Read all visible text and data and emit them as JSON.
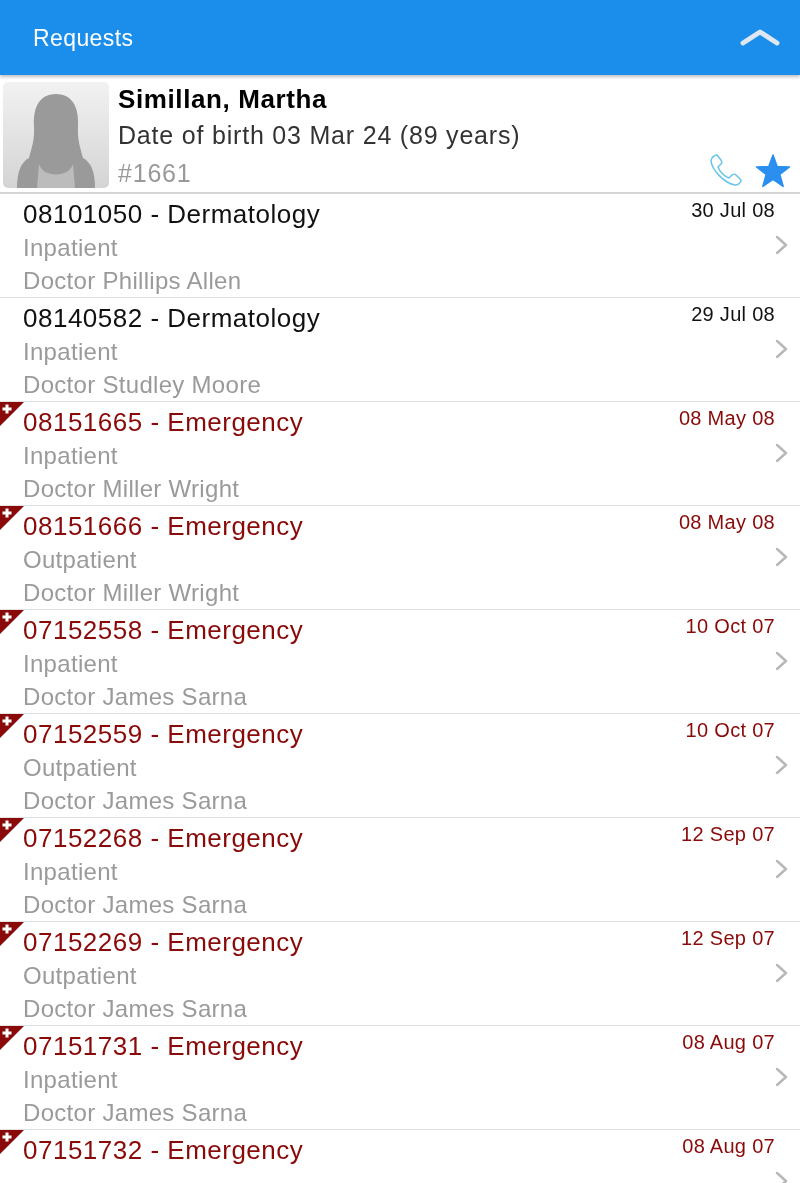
{
  "header": {
    "title": "Requests"
  },
  "patient": {
    "name": "Simillan, Martha",
    "date_of_birth": "Date of birth 03 Mar 24 (89 years)",
    "number": "#1661",
    "favorite": true
  },
  "requests": [
    {
      "title": "08101050 - Dermatology",
      "date": "30 Jul 08",
      "admission": "Inpatient",
      "doctor": "Doctor Phillips Allen",
      "emergency": false
    },
    {
      "title": "08140582 - Dermatology",
      "date": "29 Jul 08",
      "admission": "Inpatient",
      "doctor": "Doctor Studley Moore",
      "emergency": false
    },
    {
      "title": "08151665 - Emergency",
      "date": "08 May 08",
      "admission": "Inpatient",
      "doctor": "Doctor Miller Wright",
      "emergency": true
    },
    {
      "title": "08151666 - Emergency",
      "date": "08 May 08",
      "admission": "Outpatient",
      "doctor": "Doctor Miller Wright",
      "emergency": true
    },
    {
      "title": "07152558 - Emergency",
      "date": "10 Oct 07",
      "admission": "Inpatient",
      "doctor": "Doctor James Sarna",
      "emergency": true
    },
    {
      "title": "07152559 - Emergency",
      "date": "10 Oct 07",
      "admission": "Outpatient",
      "doctor": "Doctor James Sarna",
      "emergency": true
    },
    {
      "title": "07152268 - Emergency",
      "date": "12 Sep 07",
      "admission": "Inpatient",
      "doctor": "Doctor James Sarna",
      "emergency": true
    },
    {
      "title": "07152269 - Emergency",
      "date": "12 Sep 07",
      "admission": "Outpatient",
      "doctor": "Doctor James Sarna",
      "emergency": true
    },
    {
      "title": "07151731 - Emergency",
      "date": "08 Aug 07",
      "admission": "Inpatient",
      "doctor": "Doctor James Sarna",
      "emergency": true
    },
    {
      "title": "07151732 - Emergency",
      "date": "08 Aug 07",
      "emergency": true
    }
  ]
}
